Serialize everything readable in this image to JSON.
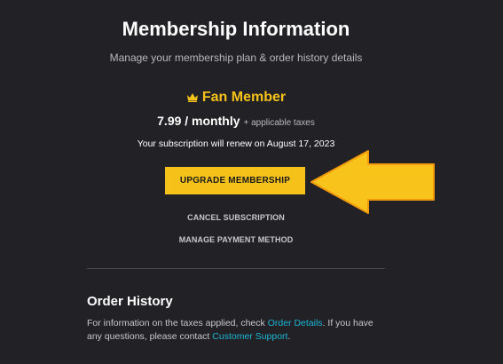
{
  "header": {
    "title": "Membership Information",
    "subtitle": "Manage your membership plan & order history details"
  },
  "plan": {
    "icon": "crown-icon",
    "name": "Fan Member",
    "price": "7.99 / monthly",
    "taxes_note": "+ applicable taxes",
    "renewal_text": "Your subscription will renew on August 17, 2023"
  },
  "actions": {
    "upgrade_label": "UPGRADE MEMBERSHIP",
    "cancel_label": "CANCEL SUBSCRIPTION",
    "manage_payment_label": "MANAGE PAYMENT METHOD"
  },
  "order_history": {
    "title": "Order History",
    "text_part1": "For information on the taxes applied, check ",
    "order_details_link": "Order Details",
    "text_part2": ". If you have any questions, please contact ",
    "support_link": "Customer Support",
    "text_part3": "."
  },
  "colors": {
    "background": "#222226",
    "accent": "#f6c21a",
    "link": "#1ab5d6",
    "arrow_fill": "#f8c31a",
    "arrow_stroke": "#f29a0c"
  }
}
